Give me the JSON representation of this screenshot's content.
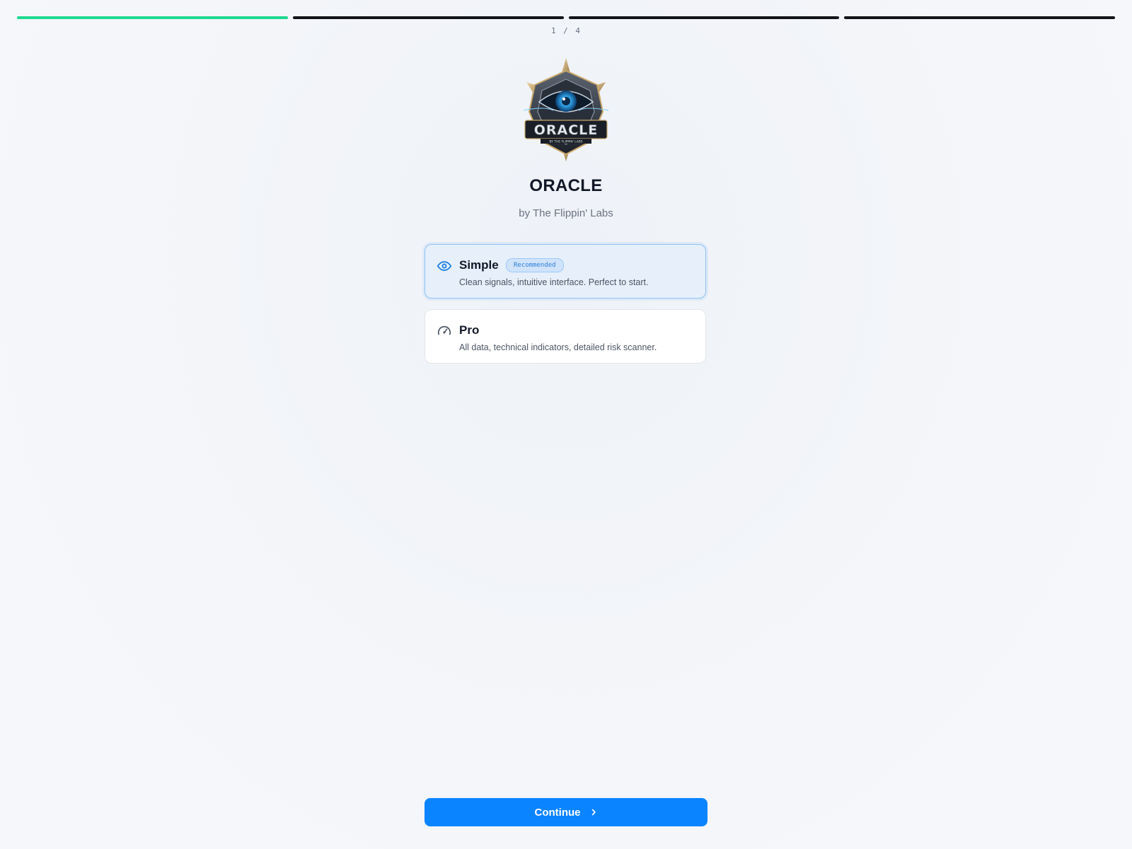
{
  "progress": {
    "current_step": 1,
    "total_steps": 4,
    "counter_text": "1 / 4",
    "active_color": "#1ed98f",
    "inactive_color": "#111318"
  },
  "brand": {
    "logo_icon": "oracle-eye-emblem-icon",
    "logo_text": "ORACLE",
    "logo_subtext": "BY THE FLIPPIN' LABS",
    "title": "ORACLE",
    "subtitle": "by The Flippin' Labs"
  },
  "modes": [
    {
      "name": "Simple",
      "icon": "eye-icon",
      "badge": "Recommended",
      "description": "Clean signals, intuitive interface. Perfect to start.",
      "selected": true
    },
    {
      "name": "Pro",
      "icon": "gauge-icon",
      "description": "All data, technical indicators, detailed risk scanner.",
      "selected": false
    }
  ],
  "footer": {
    "continue_label": "Continue",
    "continue_icon": "chevron-right-icon",
    "accent_color": "#0a84ff"
  }
}
